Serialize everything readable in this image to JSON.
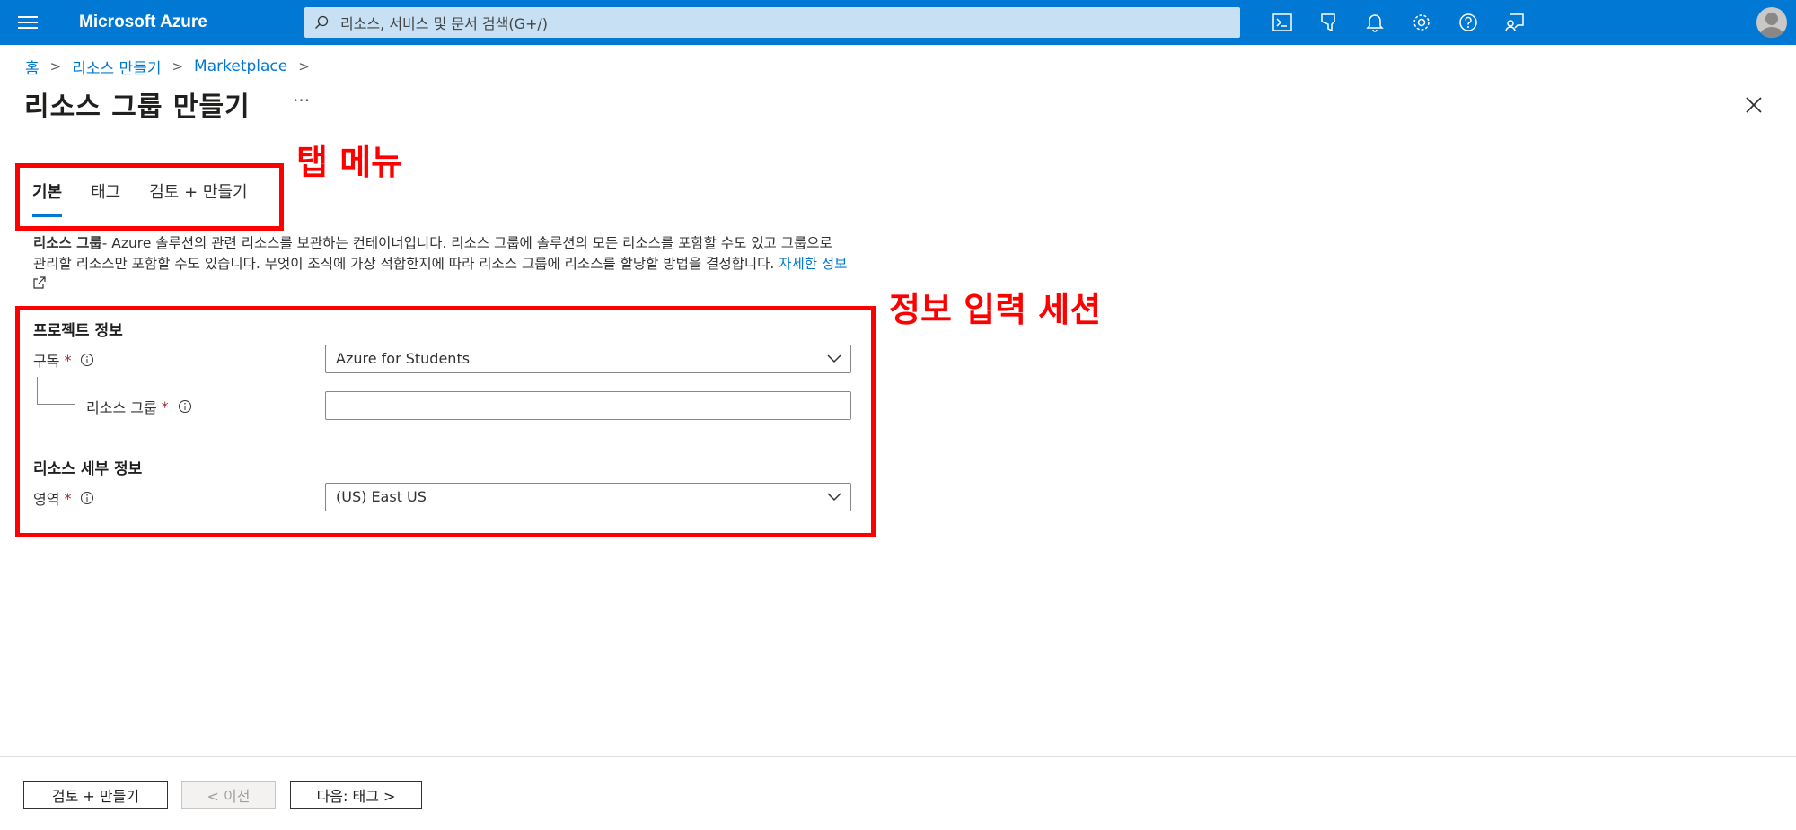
{
  "topbar": {
    "brand": "Microsoft Azure",
    "search_placeholder": "리소스, 서비스 및 문서 검색(G+/)",
    "icons": [
      "cloud-shell-icon",
      "directory-filter-icon",
      "notifications-icon",
      "settings-icon",
      "help-icon",
      "feedback-icon"
    ]
  },
  "breadcrumb": [
    "홈",
    "리소스 만들기",
    "Marketplace"
  ],
  "page": {
    "title": "리소스 그룹 만들기",
    "more": "···"
  },
  "tabs": [
    {
      "label": "기본",
      "active": true
    },
    {
      "label": "태그",
      "active": false
    },
    {
      "label": "검토 + 만들기",
      "active": false
    }
  ],
  "description": {
    "bold": "리소스 그룹",
    "text": "- Azure 솔루션의 관련 리소스를 보관하는 컨테이너입니다. 리소스 그룹에 솔루션의 모든 리소스를 포함할 수도 있고 그룹으로 관리할 리소스만 포함할 수도 있습니다. 무엇이 조직에 가장 적합한지에 따라 리소스 그룹에 리소스를 할당할 방법을 결정합니다. ",
    "link": "자세한 정보"
  },
  "project": {
    "title": "프로젝트 정보",
    "subscription_label": "구독",
    "subscription_value": "Azure for Students",
    "resource_group_label": "리소스 그룹",
    "resource_group_value": ""
  },
  "details": {
    "title": "리소스 세부 정보",
    "region_label": "영역",
    "region_value": "(US) East US"
  },
  "required_mark": "*",
  "annotations": {
    "tab_menu": "탭 메뉴",
    "input_section": "정보 입력 세션"
  },
  "footer": {
    "review_create": "검토 + 만들기",
    "previous": "< 이전",
    "next": "다음: 태그 >"
  },
  "colors": {
    "azure_blue": "#0078d4",
    "annotation_red": "#ff0000"
  }
}
